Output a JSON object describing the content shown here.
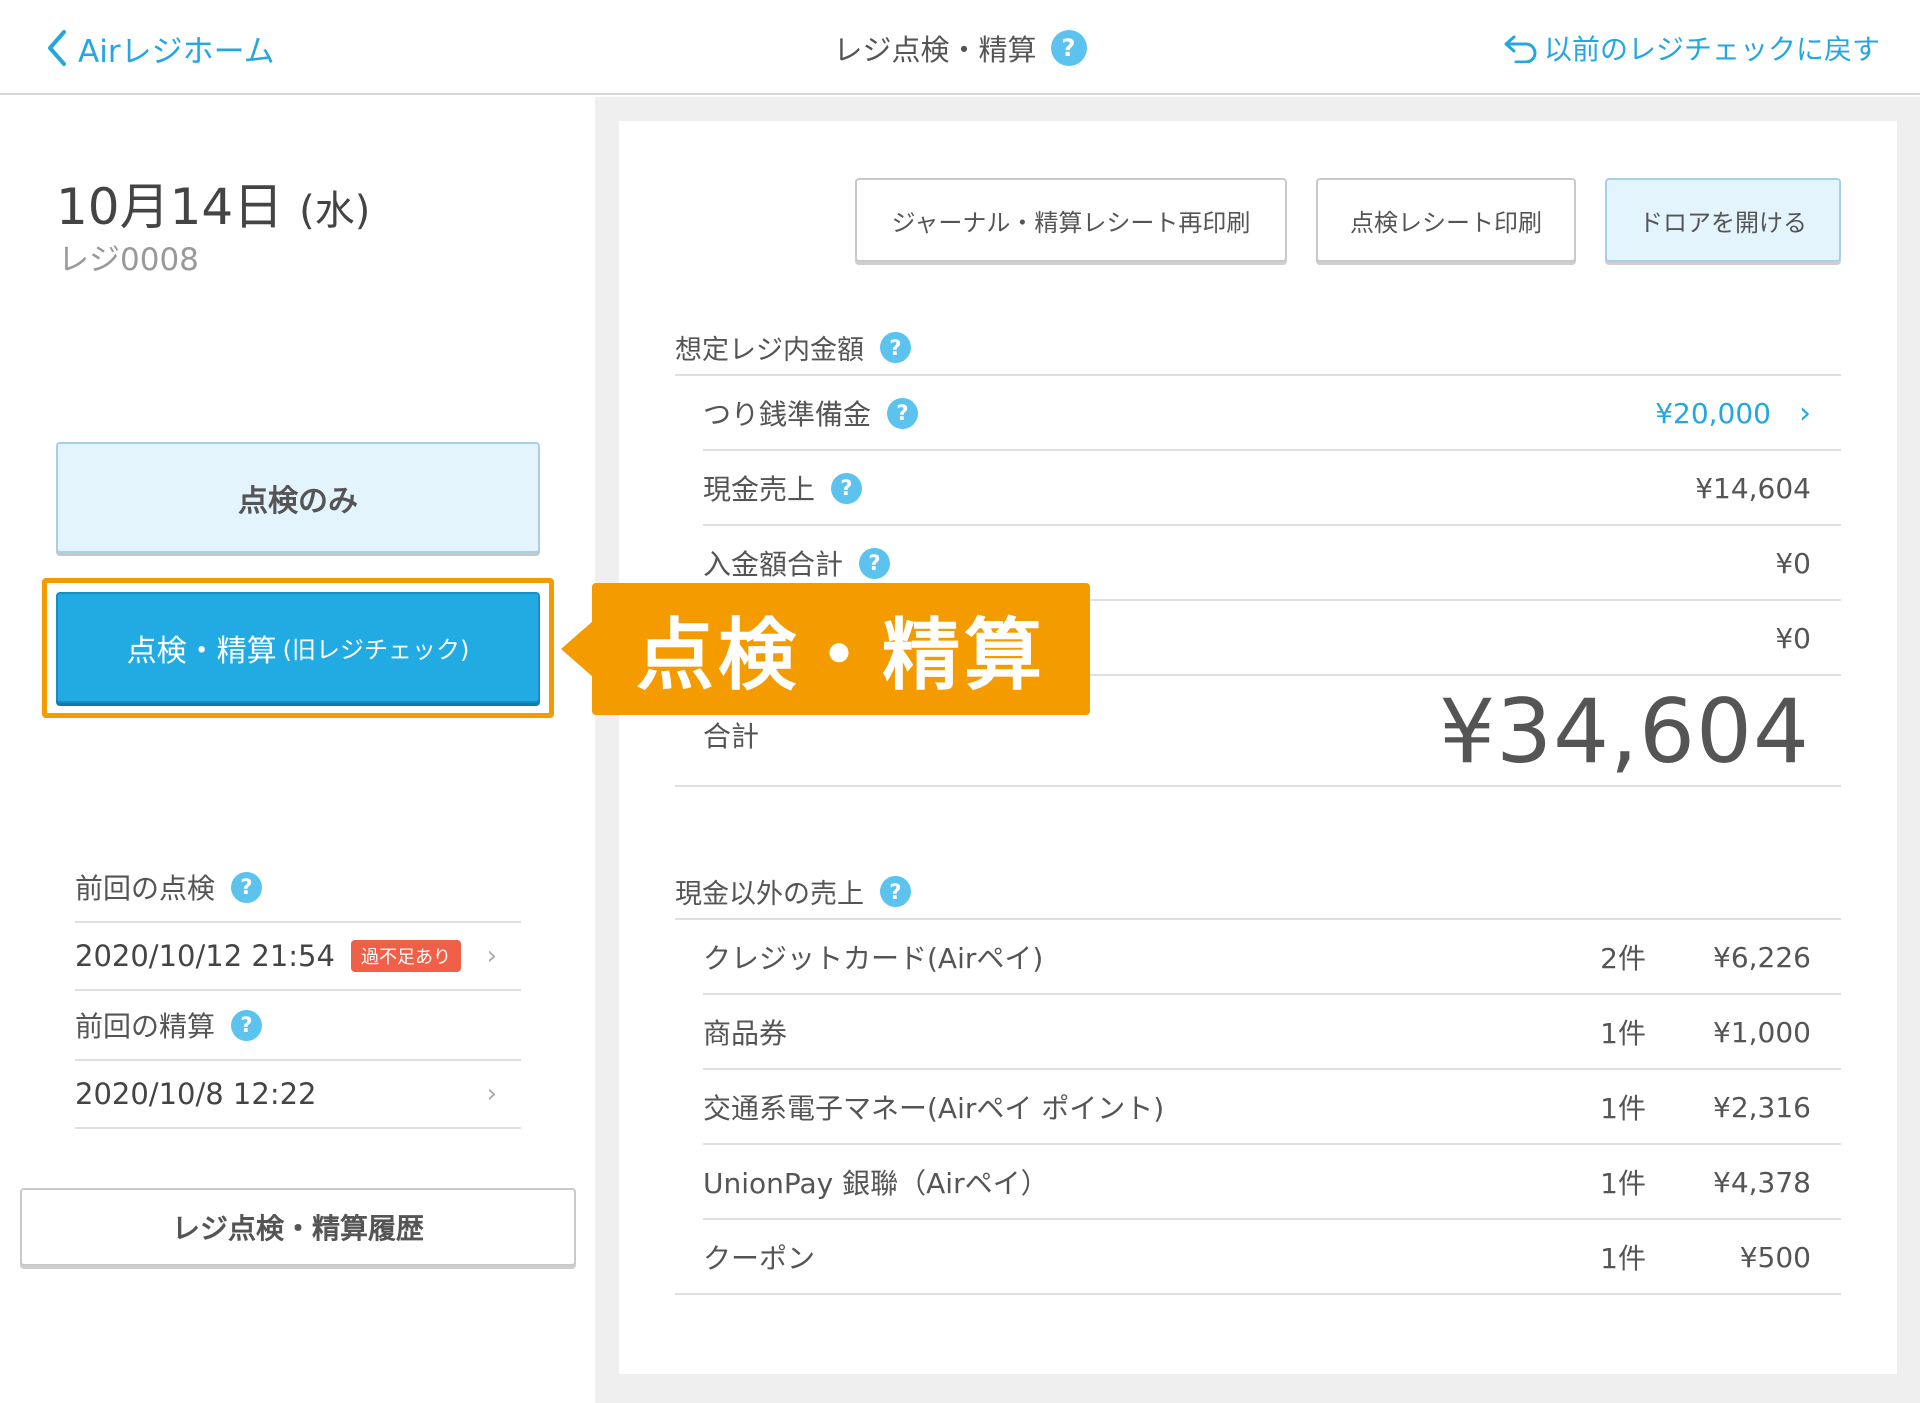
{
  "header": {
    "back_label": "Airレジホーム",
    "title": "レジ点検・精算",
    "help": "?",
    "restore_label": "以前のレジチェックに戻す"
  },
  "left": {
    "date_main": "10月14日",
    "date_weekday": "(水)",
    "register": "レジ0008",
    "check_only_label": "点検のみ",
    "settle_label": "点検・精算",
    "settle_sub": "(旧レジチェック)",
    "prev_check_label": "前回の点検",
    "prev_check_value": "2020/10/12 21:54",
    "prev_check_badge": "過不足あり",
    "prev_settle_label": "前回の精算",
    "prev_settle_value": "2020/10/8 12:22",
    "history_label": "レジ点検・精算履歴"
  },
  "toolbar": {
    "reprint_label": "ジャーナル・精算レシート再印刷",
    "print_label": "点検レシート印刷",
    "drawer_label": "ドロアを開ける"
  },
  "expected": {
    "title": "想定レジ内金額",
    "rows": [
      {
        "label": "つり銭準備金",
        "amount": "¥20,000"
      },
      {
        "label": "現金売上",
        "amount": "¥14,604"
      },
      {
        "label": "入金額合計",
        "amount": "¥0"
      },
      {
        "label": "",
        "amount": "¥0"
      }
    ],
    "total_label": "合計",
    "total_amount": "¥34,604"
  },
  "noncash": {
    "title": "現金以外の売上",
    "rows": [
      {
        "label": "クレジットカード(Airペイ)",
        "count": "2件",
        "amount": "¥6,226"
      },
      {
        "label": "商品券",
        "count": "1件",
        "amount": "¥1,000"
      },
      {
        "label": "交通系電子マネー(Airペイ ポイント)",
        "count": "1件",
        "amount": "¥2,316"
      },
      {
        "label": "UnionPay 銀聯（Airペイ）",
        "count": "1件",
        "amount": "¥4,378"
      },
      {
        "label": "クーポン",
        "count": "1件",
        "amount": "¥500"
      }
    ]
  },
  "callout": {
    "text": "点検・精算"
  },
  "colors": {
    "accent": "#24a7e0",
    "primary_button": "#22abe3",
    "highlight": "#f49b00",
    "badge": "#f06048"
  }
}
